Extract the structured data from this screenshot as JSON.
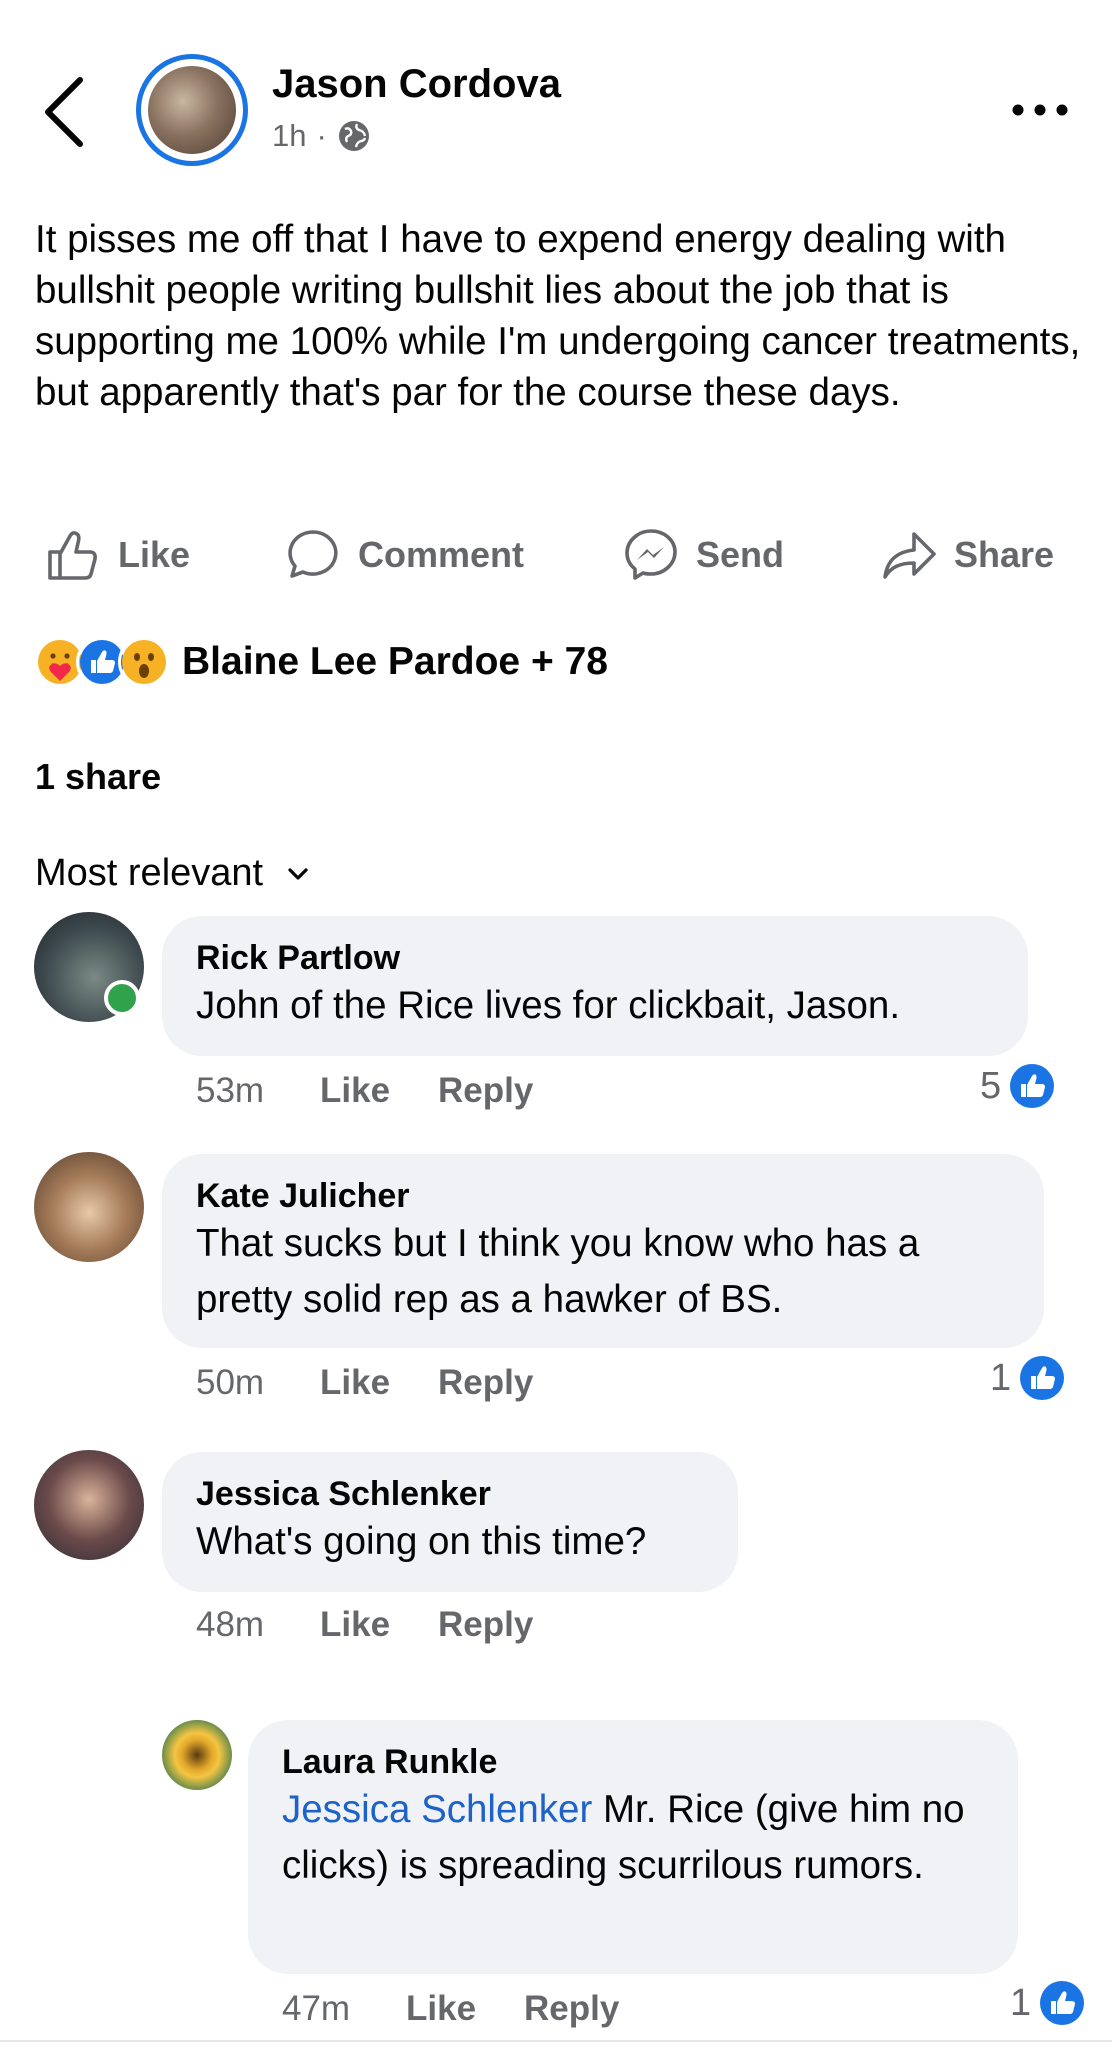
{
  "post": {
    "author": "Jason Cordova",
    "time": "1h",
    "separator": "·",
    "text": "It pisses me off that I have to expend energy dealing with bullshit people writing bullshit lies about the job that is supporting me 100% while I'm undergoing cancer treatments, but apparently that's par for the course these days."
  },
  "actions": {
    "like": "Like",
    "comment": "Comment",
    "send": "Send",
    "share": "Share"
  },
  "reactions": {
    "icons": [
      "care-emoji",
      "like-emoji",
      "wow-emoji"
    ],
    "summary": "Blaine Lee Pardoe + 78"
  },
  "shares": "1 share",
  "sort_label": "Most relevant",
  "comments": [
    {
      "name": "Rick Partlow",
      "text": "John of the Rice lives for clickbait, Jason.",
      "time": "53m",
      "like": "Like",
      "reply": "Reply",
      "count": "5"
    },
    {
      "name": "Kate Julicher",
      "text": "That sucks but I think you know who has a pretty solid rep as a hawker of BS.",
      "time": "50m",
      "like": "Like",
      "reply": "Reply",
      "count": "1"
    },
    {
      "name": "Jessica Schlenker",
      "text": "What's going on this time?",
      "time": "48m",
      "like": "Like",
      "reply": "Reply"
    }
  ],
  "reply": {
    "name": "Laura Runkle",
    "mention": "Jessica Schlenker",
    "text": "Mr. Rice (give him no clicks) is spreading scurrilous rumors.",
    "time": "47m",
    "like": "Like",
    "reply": "Reply",
    "count": "1"
  },
  "colors": {
    "accent": "#1b74e4",
    "mention": "#1d62c8",
    "secondary_text": "#65676b",
    "bubble": "#f0f2f5",
    "online": "#31a24c"
  }
}
